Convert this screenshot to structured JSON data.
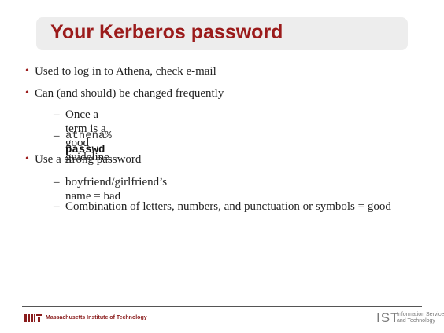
{
  "slide": {
    "title": "Your Kerberos password",
    "bullets": [
      {
        "level": 1,
        "text": "Used to log in to Athena, check e-mail"
      },
      {
        "level": 1,
        "text": "Can (and should) be changed frequently"
      },
      {
        "level": 2,
        "text": "Once a term is a good guideline"
      },
      {
        "level": 2,
        "prompt": "athena% ",
        "command": "passwd"
      },
      {
        "level": 1,
        "text": "Use a strong password"
      },
      {
        "level": 2,
        "text": "boyfriend/girlfriend’s name = bad"
      },
      {
        "level": 2,
        "text": "Combination of letters, numbers, and punctuation or symbols = good"
      }
    ],
    "bullet_glyph_level1": "•",
    "bullet_glyph_level2": "–"
  },
  "footer": {
    "institution": "Massachusetts Institute of Technology",
    "ist_mark": "IST",
    "ist_line1": "Information Services",
    "ist_line2": "and Technology"
  },
  "colors": {
    "title": "#9b1b1b",
    "title_box": "#ededed",
    "mit_red": "#8a1c1c",
    "ist_gray": "#7a7a7a"
  }
}
